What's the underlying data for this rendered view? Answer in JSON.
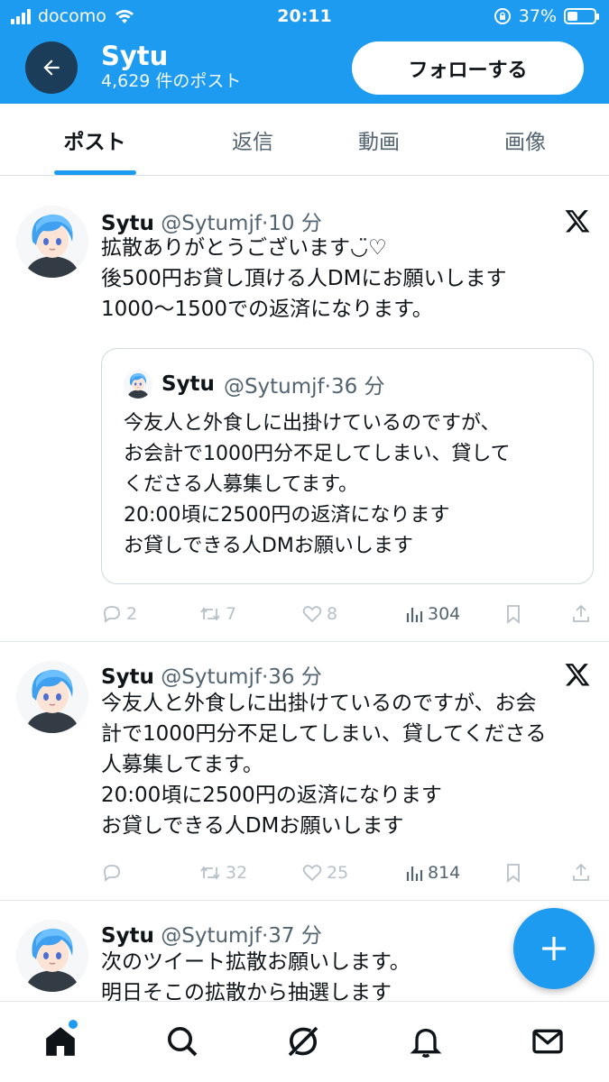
{
  "status_bar": {
    "carrier": "docomo",
    "time": "20:11",
    "battery": "37%"
  },
  "header": {
    "name": "Sytu",
    "post_count": "4,629 件のポスト",
    "follow_label": "フォローする",
    "background_color": "#1d9bf0"
  },
  "tabs": [
    {
      "label": "ポスト",
      "active": true
    },
    {
      "label": "返信",
      "active": false
    },
    {
      "label": "動画",
      "active": false
    },
    {
      "label": "画像",
      "active": false
    }
  ],
  "tweets": [
    {
      "name": "Sytu",
      "handle": "@Sytumjf",
      "time": "10 分",
      "lines": [
        "拡散ありがとうございます◡̈♡",
        "後500円お貸し頂ける人DMにお願いします",
        "1000〜1500での返済になります。"
      ],
      "quote": {
        "name": "Sytu",
        "handle": "@Sytumjf",
        "time": "36 分",
        "lines": [
          "今友人と外食しに出掛けているのですが、",
          "お会計で1000円分不足してしまい、貸して",
          "くださる人募集してます。",
          "20:00頃に2500円の返済になります",
          "お貸しできる人DMお願いします"
        ]
      },
      "replies": "2",
      "reposts": "7",
      "likes": "8",
      "views": "304"
    },
    {
      "name": "Sytu",
      "handle": "@Sytumjf",
      "time": "36 分",
      "lines": [
        "今友人と外食しに出掛けているのですが、お会",
        "計で1000円分不足してしまい、貸してくださる",
        "人募集してます。",
        "20:00頃に2500円の返済になります",
        "お貸しできる人DMお願いします"
      ],
      "replies": "",
      "reposts": "32",
      "likes": "25",
      "views": "814"
    },
    {
      "name": "Sytu",
      "handle": "@Sytumjf",
      "time": "37 分",
      "lines": [
        "次のツイート拡散お願いします。",
        "明日そこの拡散から抽選します"
      ]
    }
  ],
  "icons": {
    "back": "arrow-left-icon",
    "x_logo": "x-logo-icon",
    "reply": "reply-icon",
    "repost": "repost-icon",
    "like": "heart-icon",
    "views": "views-icon",
    "bookmark": "bookmark-icon",
    "share": "share-icon",
    "compose": "plus-icon",
    "nav": [
      "home-icon",
      "search-icon",
      "grok-icon",
      "bell-icon",
      "mail-icon"
    ]
  }
}
